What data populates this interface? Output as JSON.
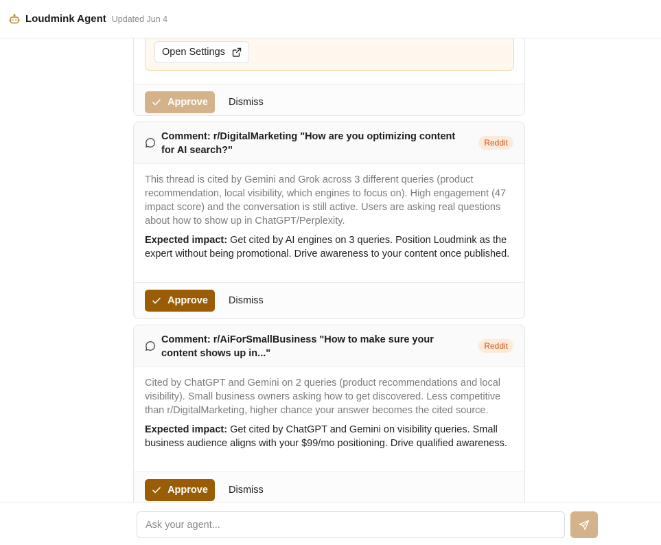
{
  "header": {
    "agent_name": "Loudmink Agent",
    "updated": "Updated Jun 4"
  },
  "cards": [
    {
      "open_settings_label": "Open Settings",
      "approve_label": "Approve",
      "dismiss_label": "Dismiss",
      "approve_enabled": false
    },
    {
      "title": "Comment: r/DigitalMarketing \"How are you optimizing content for AI search?\"",
      "badge": "Reddit",
      "description": "This thread is cited by Gemini and Grok across 3 different queries (product recommendation, local visibility, which engines to focus on). High engagement (47 impact score) and the conversation is still active. Users are asking real questions about how to show up in ChatGPT/Perplexity.",
      "impact_label": "Expected impact:",
      "impact_text": " Get cited by AI engines on 3 queries. Position Loudmink as the expert without being promotional. Drive awareness to your content once published.",
      "approve_label": "Approve",
      "dismiss_label": "Dismiss",
      "approve_enabled": true
    },
    {
      "title": "Comment: r/AiForSmallBusiness \"How to make sure your content shows up in...\"",
      "badge": "Reddit",
      "description": "Cited by ChatGPT and Gemini on 2 queries (product recommendations and local visibility). Small business owners asking how to get discovered. Less competitive than r/DigitalMarketing, higher chance your answer becomes the cited source.",
      "impact_label": "Expected impact:",
      "impact_text": " Get cited by ChatGPT and Gemini on visibility queries. Small business audience aligns with your $99/mo positioning. Drive qualified awareness.",
      "approve_label": "Approve",
      "dismiss_label": "Dismiss",
      "approve_enabled": true
    }
  ],
  "composer": {
    "placeholder": "Ask your agent..."
  },
  "icons": {
    "agent": "robot-icon",
    "comment": "comment-icon",
    "external": "external-link-icon",
    "check": "check-icon",
    "send": "send-icon"
  },
  "colors": {
    "accent": "#9a5d06",
    "accent_disabled": "#d4b38a",
    "badge_bg": "#fdebd9",
    "badge_text": "#c4551a",
    "warning_bg": "#fff8ee",
    "warning_border": "#f4d8a8"
  }
}
